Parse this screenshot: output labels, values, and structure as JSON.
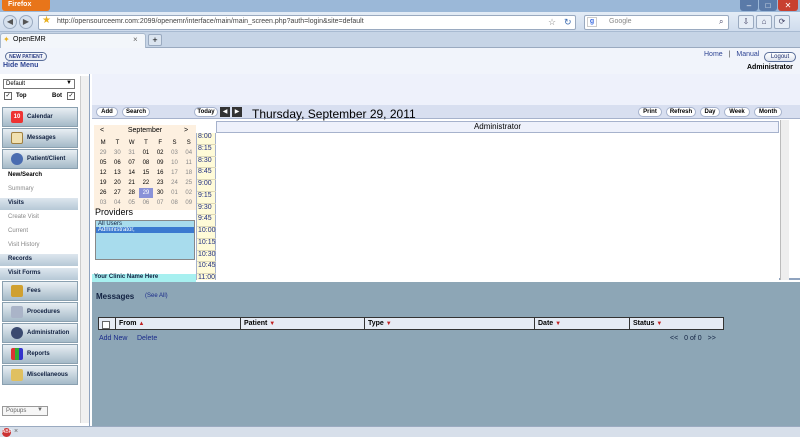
{
  "browser": {
    "menu_button": "Firefox",
    "url": "http://opensourceemr.com:2099/openemr/interface/main/main_screen.php?auth=login&site=default",
    "search_placeholder": "Google",
    "tab_title": "OpenEMR",
    "new_tab": "+"
  },
  "header": {
    "new_patient": "NEW PATIENT",
    "hide_menu": "Hide Menu",
    "home": "Home",
    "separator": "|",
    "manual": "Manual",
    "logout": "Logout",
    "user": "Administrator"
  },
  "nav": {
    "profile_select": "Default",
    "top_label": "Top",
    "bot_label": "Bot",
    "calendar": "Calendar",
    "messages": "Messages",
    "patient_client": "Patient/Client",
    "new_search": "New/Search",
    "summary": "Summary",
    "visits": "Visits",
    "create_visit": "Create Visit",
    "current": "Current",
    "visit_history": "Visit History",
    "records": "Records",
    "visit_forms": "Visit Forms",
    "fees": "Fees",
    "procedures": "Procedures",
    "administration": "Administration",
    "reports": "Reports",
    "miscellaneous": "Miscellaneous",
    "popups": "Popups"
  },
  "calendar": {
    "add": "Add",
    "search": "Search",
    "today": "Today",
    "prev": "◀",
    "next": "▶",
    "date_title": "Thursday, September 29, 2011",
    "print": "Print",
    "refresh": "Refresh",
    "day": "Day",
    "week": "Week",
    "month": "Month",
    "provider_column": "Administrator",
    "mini": {
      "prev": "<",
      "month": "September",
      "next": ">",
      "weekdays": [
        "M",
        "T",
        "W",
        "T",
        "F",
        "S",
        "S"
      ],
      "weeks": [
        [
          "29",
          "30",
          "31",
          "01",
          "02",
          "03",
          "04"
        ],
        [
          "05",
          "06",
          "07",
          "08",
          "09",
          "10",
          "11"
        ],
        [
          "12",
          "13",
          "14",
          "15",
          "16",
          "17",
          "18"
        ],
        [
          "19",
          "20",
          "21",
          "22",
          "23",
          "24",
          "25"
        ],
        [
          "26",
          "27",
          "28",
          "29",
          "30",
          "01",
          "02"
        ],
        [
          "03",
          "04",
          "05",
          "06",
          "07",
          "08",
          "09"
        ]
      ],
      "selected": "29"
    },
    "providers_label": "Providers",
    "providers": [
      "All Users",
      "Administrator,"
    ],
    "clinic": "Your Clinic Name Here",
    "times": [
      "8:00",
      "8:15",
      "8:30",
      "8:45",
      "9:00",
      "9:15",
      "9:30",
      "9:45",
      "10:00",
      "10:15",
      "10:30",
      "10:45",
      "11:00"
    ]
  },
  "messages": {
    "title": "Messages",
    "see_all": "(See All)",
    "columns": [
      "From",
      "Patient",
      "Type",
      "Date",
      "Status"
    ],
    "add_new": "Add New",
    "delete": "Delete",
    "pager_prev": "<<",
    "pager_text": "0 of 0",
    "pager_next": ">>"
  }
}
